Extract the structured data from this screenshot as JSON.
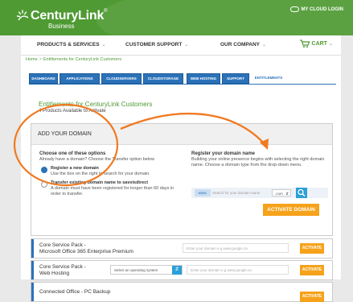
{
  "header": {
    "brand": "CenturyLink",
    "brand_tm": "®",
    "brand_sub": "Business",
    "cloud_login": "MY CLOUD LOGIN"
  },
  "nav": {
    "items": [
      {
        "label": "PRODUCTS & SERVICES"
      },
      {
        "label": "CUSTOMER SUPPORT"
      },
      {
        "label": "OUR COMPANY"
      }
    ],
    "cart_label": "CART"
  },
  "breadcrumb": {
    "home": "Home",
    "separator": ">",
    "current": "Entitlements for CenturyLink Customers"
  },
  "tabs": [
    {
      "label": "DASHBOARD"
    },
    {
      "label": "APPLICATIONS"
    },
    {
      "label": "CLOUDSERVERS"
    },
    {
      "label": "CLOUDSTORAGE"
    },
    {
      "label": "WEB HOSTING"
    },
    {
      "label": "SUPPORT"
    },
    {
      "label": "ENTITLEMENTS"
    }
  ],
  "active_tab": "ENTITLEMENTS",
  "content": {
    "title": "Entitlements for CenturyLink Customers",
    "subtitle": "4 Products Available to Activate"
  },
  "domain": {
    "heading": "ADD YOUR DOMAIN",
    "left": {
      "title": "Choose one of these options",
      "desc": "Already have a domain? Choose the Transfer option below",
      "options": [
        {
          "label": "Register a new domain",
          "desc": "Use the box on the right to search for your domain.",
          "selected": true
        },
        {
          "label": "Transfer existing domain name to savvisdirect",
          "desc": "A domain must have been registered for longer than 60 days in order to transfer.",
          "selected": false
        }
      ]
    },
    "right": {
      "title": "Register your domain name",
      "desc": "Building your online presence begins with selecting the right domain name. Choose a domain type from the drop-down menu.",
      "www": "www.",
      "search_placeholder": "Search for your domain name",
      "tld": ".com",
      "activate_label": "ACTIVATE DOMAIN"
    }
  },
  "products": [
    {
      "name": "Core Service Pack -",
      "name2": "Microsoft Office 365 Enterprise Premium",
      "placeholder": "Enter your domain e.g www.google.ca",
      "action": "ACTIVATE"
    },
    {
      "name": "Core Service Pack -",
      "name2": "Web Hosting",
      "select": "Select an operating system",
      "placeholder": "Enter your domain e.g www.google.ca",
      "action": "ACTIVATE"
    },
    {
      "name": "Connected Office - PC Backup",
      "name2": "",
      "action": "ACTIVATE"
    }
  ],
  "colors": {
    "brand_green": "#4f9a33",
    "primary_blue": "#2b72b9",
    "accent_orange": "#f6a21a",
    "annotation_orange": "#f07a22"
  }
}
